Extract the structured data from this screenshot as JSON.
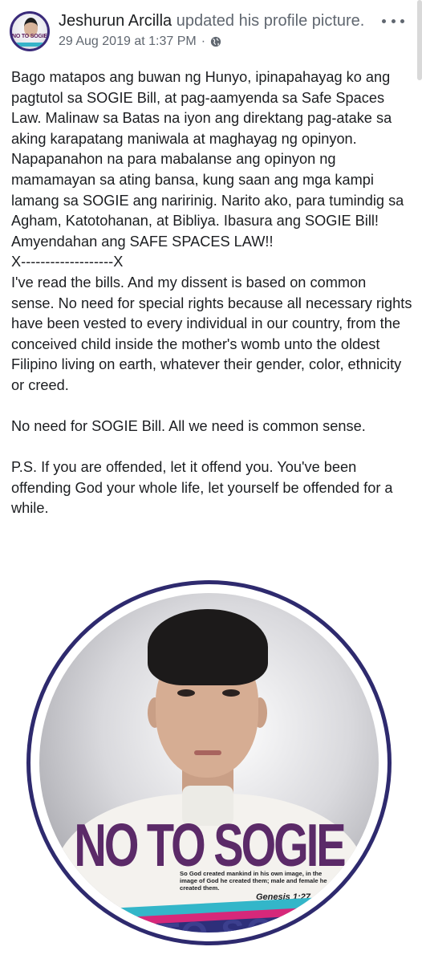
{
  "post": {
    "author_name": "Jeshurun Arcilla",
    "action_text": " updated his profile picture.",
    "timestamp": "29 Aug 2019 at 1:37 PM",
    "separator": " · ",
    "audience_icon": "globe-icon",
    "more_icon": "more-options-icon"
  },
  "avatar": {
    "text": "NO TO SOGIE"
  },
  "body": {
    "paragraph_1": "Bago matapos ang buwan ng Hunyo, ipinapahayag ko ang pagtutol sa SOGIE Bill, at pag-aamyenda sa Safe Spaces Law. Malinaw sa Batas na iyon ang direktang pag-atake sa aking karapatang maniwala at maghayag ng opinyon. Napapanahon na para mabalanse ang opinyon ng mamamayan sa ating bansa, kung saan ang mga kampi lamang sa SOGIE ang naririnig. Narito ako, para tumindig sa Agham, Katotohanan, at Bibliya. Ibasura ang SOGIE Bill! Amyendahan ang SAFE SPACES LAW!!",
    "divider": "X-------------------X",
    "paragraph_2": "I've read the bills. And my dissent is based on common sense. No need for special rights because all necessary rights have been vested to every individual in our country, from the conceived child inside the mother's womb unto the oldest Filipino living on earth, whatever their gender, color, ethnicity or creed.",
    "paragraph_3": "No need for SOGIE Bill. All we need is common sense.",
    "paragraph_4": "P.S. If you are offended, let it offend you. You've been offending God your whole life, let yourself be offended for a while."
  },
  "profile_picture": {
    "slogan": "NO TO SOGIE",
    "verse": "So God created mankind in his own image, in the image of God he created them; male and female he created them.",
    "verse_reference": "Genesis 1:27",
    "band_text": "NO TO SOGIE",
    "colors": {
      "ring": "#2e2a6e",
      "slogan": "#5b2a68",
      "band_teal": "#33b6c9",
      "band_pink": "#d6287a",
      "band_navy": "#2d2f7a"
    }
  }
}
